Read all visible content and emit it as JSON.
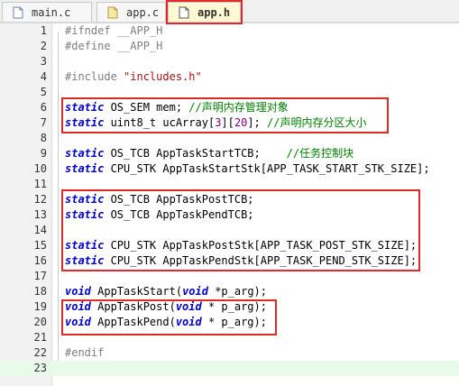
{
  "tabs": [
    {
      "label": "main.c",
      "active": false
    },
    {
      "label": "app.c",
      "active": false
    },
    {
      "label": "app.h",
      "active": true
    }
  ],
  "lines": [
    {
      "n": "1",
      "tokens": [
        {
          "c": "pp",
          "t": "#ifndef __APP_H"
        }
      ]
    },
    {
      "n": "2",
      "tokens": [
        {
          "c": "pp",
          "t": "#define __APP_H"
        }
      ]
    },
    {
      "n": "3",
      "tokens": []
    },
    {
      "n": "4",
      "tokens": [
        {
          "c": "pp",
          "t": "#include "
        },
        {
          "c": "st",
          "t": "\"includes.h\""
        }
      ]
    },
    {
      "n": "5",
      "tokens": []
    },
    {
      "n": "6",
      "tokens": [
        {
          "c": "kw",
          "t": "static"
        },
        {
          "c": "tx",
          "t": " OS_SEM mem; "
        },
        {
          "c": "cm",
          "t": "//声明内存管理对象"
        }
      ]
    },
    {
      "n": "7",
      "tokens": [
        {
          "c": "kw",
          "t": "static"
        },
        {
          "c": "tx",
          "t": " uint8_t ucArray["
        },
        {
          "c": "num",
          "t": "3"
        },
        {
          "c": "tx",
          "t": "]["
        },
        {
          "c": "num",
          "t": "20"
        },
        {
          "c": "tx",
          "t": "]; "
        },
        {
          "c": "cm",
          "t": "//声明内存分区大小"
        }
      ]
    },
    {
      "n": "8",
      "tokens": []
    },
    {
      "n": "9",
      "tokens": [
        {
          "c": "kw",
          "t": "static"
        },
        {
          "c": "tx",
          "t": " OS_TCB AppTaskStartTCB;    "
        },
        {
          "c": "cm",
          "t": "//任务控制块"
        }
      ]
    },
    {
      "n": "10",
      "tokens": [
        {
          "c": "kw",
          "t": "static"
        },
        {
          "c": "tx",
          "t": " CPU_STK AppTaskStartStk[APP_TASK_START_STK_SIZE];"
        }
      ]
    },
    {
      "n": "11",
      "tokens": []
    },
    {
      "n": "12",
      "tokens": [
        {
          "c": "kw",
          "t": "static"
        },
        {
          "c": "tx",
          "t": " OS_TCB AppTaskPostTCB;"
        }
      ]
    },
    {
      "n": "13",
      "tokens": [
        {
          "c": "kw",
          "t": "static"
        },
        {
          "c": "tx",
          "t": " OS_TCB AppTaskPendTCB;"
        }
      ]
    },
    {
      "n": "14",
      "tokens": []
    },
    {
      "n": "15",
      "tokens": [
        {
          "c": "kw",
          "t": "static"
        },
        {
          "c": "tx",
          "t": " CPU_STK AppTaskPostStk[APP_TASK_POST_STK_SIZE];"
        }
      ]
    },
    {
      "n": "16",
      "tokens": [
        {
          "c": "kw",
          "t": "static"
        },
        {
          "c": "tx",
          "t": " CPU_STK AppTaskPendStk[APP_TASK_PEND_STK_SIZE];"
        }
      ]
    },
    {
      "n": "17",
      "tokens": []
    },
    {
      "n": "18",
      "tokens": [
        {
          "c": "kw",
          "t": "void"
        },
        {
          "c": "tx",
          "t": " AppTaskStart("
        },
        {
          "c": "kw",
          "t": "void"
        },
        {
          "c": "tx",
          "t": " *p_arg);"
        }
      ]
    },
    {
      "n": "19",
      "tokens": [
        {
          "c": "kw",
          "t": "void"
        },
        {
          "c": "tx",
          "t": " AppTaskPost("
        },
        {
          "c": "kw",
          "t": "void"
        },
        {
          "c": "tx",
          "t": " * p_arg);"
        }
      ]
    },
    {
      "n": "20",
      "tokens": [
        {
          "c": "kw",
          "t": "void"
        },
        {
          "c": "tx",
          "t": " AppTaskPend("
        },
        {
          "c": "kw",
          "t": "void"
        },
        {
          "c": "tx",
          "t": " * p_arg);"
        }
      ]
    },
    {
      "n": "21",
      "tokens": []
    },
    {
      "n": "22",
      "tokens": [
        {
          "c": "pp",
          "t": "#endif"
        }
      ]
    },
    {
      "n": "23",
      "tokens": []
    }
  ],
  "current_line": "23",
  "colors": {
    "keyword": "#0000cd",
    "comment": "#008000",
    "preprocessor": "#7f7f7f",
    "string": "#a31515",
    "number": "#800080",
    "highlight_box": "#e02a2a",
    "active_tab": "#fff8d2"
  }
}
